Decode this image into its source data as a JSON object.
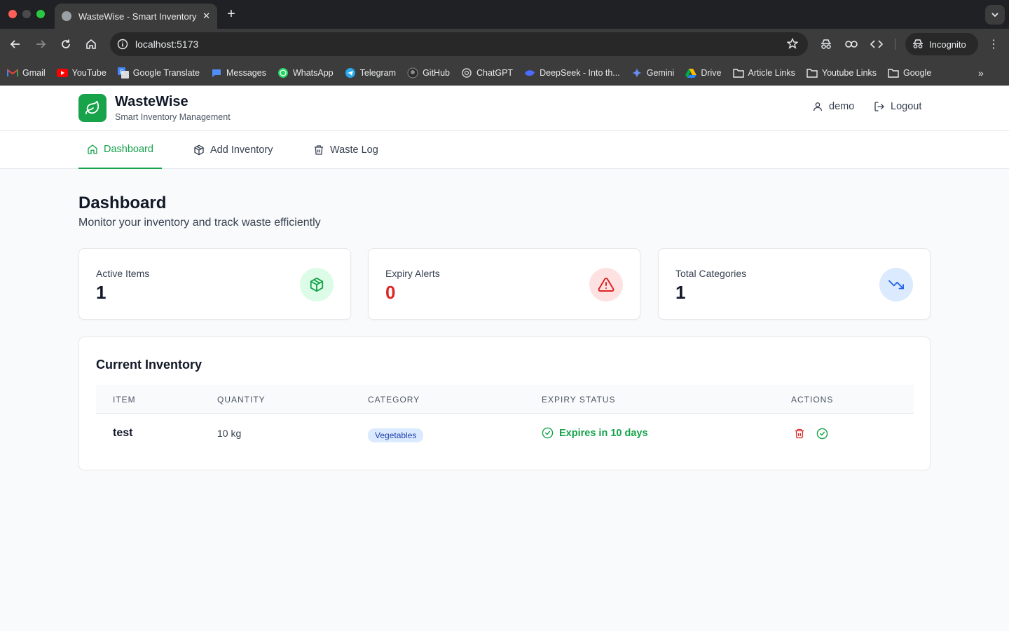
{
  "browser": {
    "tab_title": "WasteWise - Smart Inventory",
    "url": "localhost:5173",
    "incognito_label": "Incognito",
    "bookmarks": [
      {
        "label": "Gmail",
        "icon": "gmail-icon"
      },
      {
        "label": "YouTube",
        "icon": "youtube-icon"
      },
      {
        "label": "Google Translate",
        "icon": "translate-icon"
      },
      {
        "label": "Messages",
        "icon": "messages-icon"
      },
      {
        "label": "WhatsApp",
        "icon": "whatsapp-icon"
      },
      {
        "label": "Telegram",
        "icon": "telegram-icon"
      },
      {
        "label": "GitHub",
        "icon": "github-icon"
      },
      {
        "label": "ChatGPT",
        "icon": "chatgpt-icon"
      },
      {
        "label": "DeepSeek - Into th...",
        "icon": "deepseek-icon"
      },
      {
        "label": "Gemini",
        "icon": "gemini-icon"
      },
      {
        "label": "Drive",
        "icon": "drive-icon"
      },
      {
        "label": "Article Links",
        "icon": "folder-icon"
      },
      {
        "label": "Youtube Links",
        "icon": "folder-icon"
      },
      {
        "label": "Google",
        "icon": "folder-icon"
      }
    ]
  },
  "header": {
    "brand": "WasteWise",
    "tagline": "Smart Inventory Management",
    "username": "demo",
    "logout_label": "Logout"
  },
  "nav": {
    "tabs": [
      {
        "label": "Dashboard",
        "active": true
      },
      {
        "label": "Add Inventory",
        "active": false
      },
      {
        "label": "Waste Log",
        "active": false
      }
    ]
  },
  "page": {
    "title": "Dashboard",
    "subtitle": "Monitor your inventory and track waste efficiently"
  },
  "stats": [
    {
      "label": "Active Items",
      "value": "1",
      "icon": "package-icon",
      "color": "#16a34a"
    },
    {
      "label": "Expiry Alerts",
      "value": "0",
      "icon": "alert-triangle-icon",
      "color": "#dc2626"
    },
    {
      "label": "Total Categories",
      "value": "1",
      "icon": "trending-down-icon",
      "color": "#2563eb"
    }
  ],
  "inventory": {
    "title": "Current Inventory",
    "columns": [
      "ITEM",
      "QUANTITY",
      "CATEGORY",
      "EXPIRY STATUS",
      "ACTIONS"
    ],
    "rows": [
      {
        "item": "test",
        "quantity": "10 kg",
        "category": "Vegetables",
        "expiry": "Expires in 10 days"
      }
    ]
  },
  "colors": {
    "accent": "#16a34a",
    "danger": "#dc2626",
    "info": "#2563eb"
  }
}
